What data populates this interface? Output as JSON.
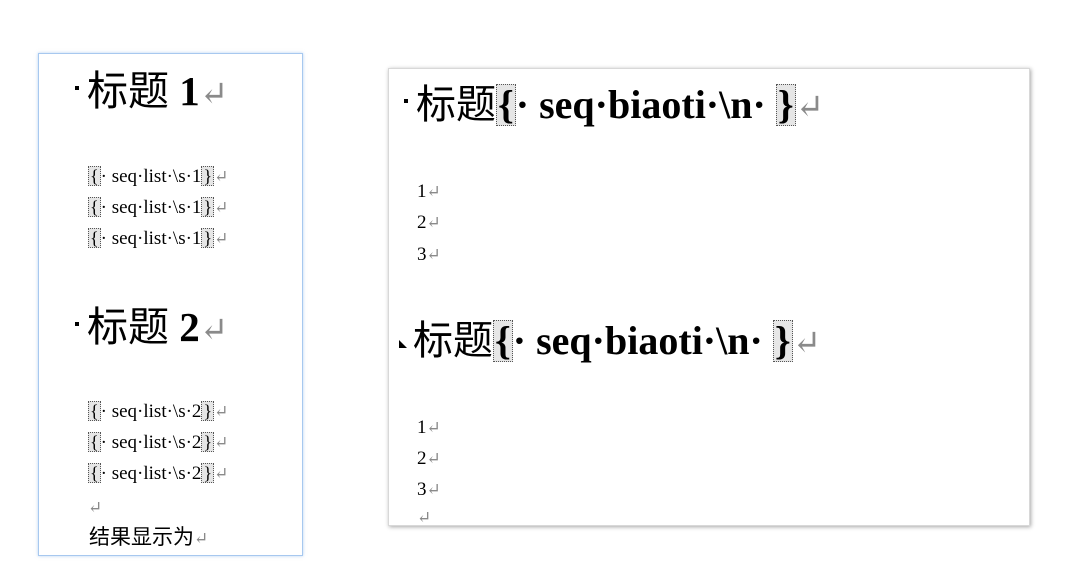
{
  "left_page": {
    "heading1": {
      "cn": "标题",
      "num": " 1"
    },
    "list1": [
      "· seq·list·\\s·1",
      "· seq·list·\\s·1",
      "· seq·list·\\s·1"
    ],
    "heading2": {
      "cn": "标题",
      "num": " 2"
    },
    "list2": [
      "· seq·list·\\s·2",
      "· seq·list·\\s·2",
      "· seq·list·\\s·2"
    ],
    "result_text": "结果显示为"
  },
  "right_page": {
    "heading1": {
      "cn": "标题",
      "field_code": "· seq·biaoti·\\n· "
    },
    "numbers1": [
      "1",
      "2",
      "3"
    ],
    "heading2": {
      "cn": "标题",
      "field_code": "· seq·biaoti·\\n· "
    },
    "numbers2": [
      "1",
      "2",
      "3"
    ]
  },
  "symbols": {
    "paragraph_mark": "↵",
    "field_open": "{",
    "field_close": "}"
  }
}
